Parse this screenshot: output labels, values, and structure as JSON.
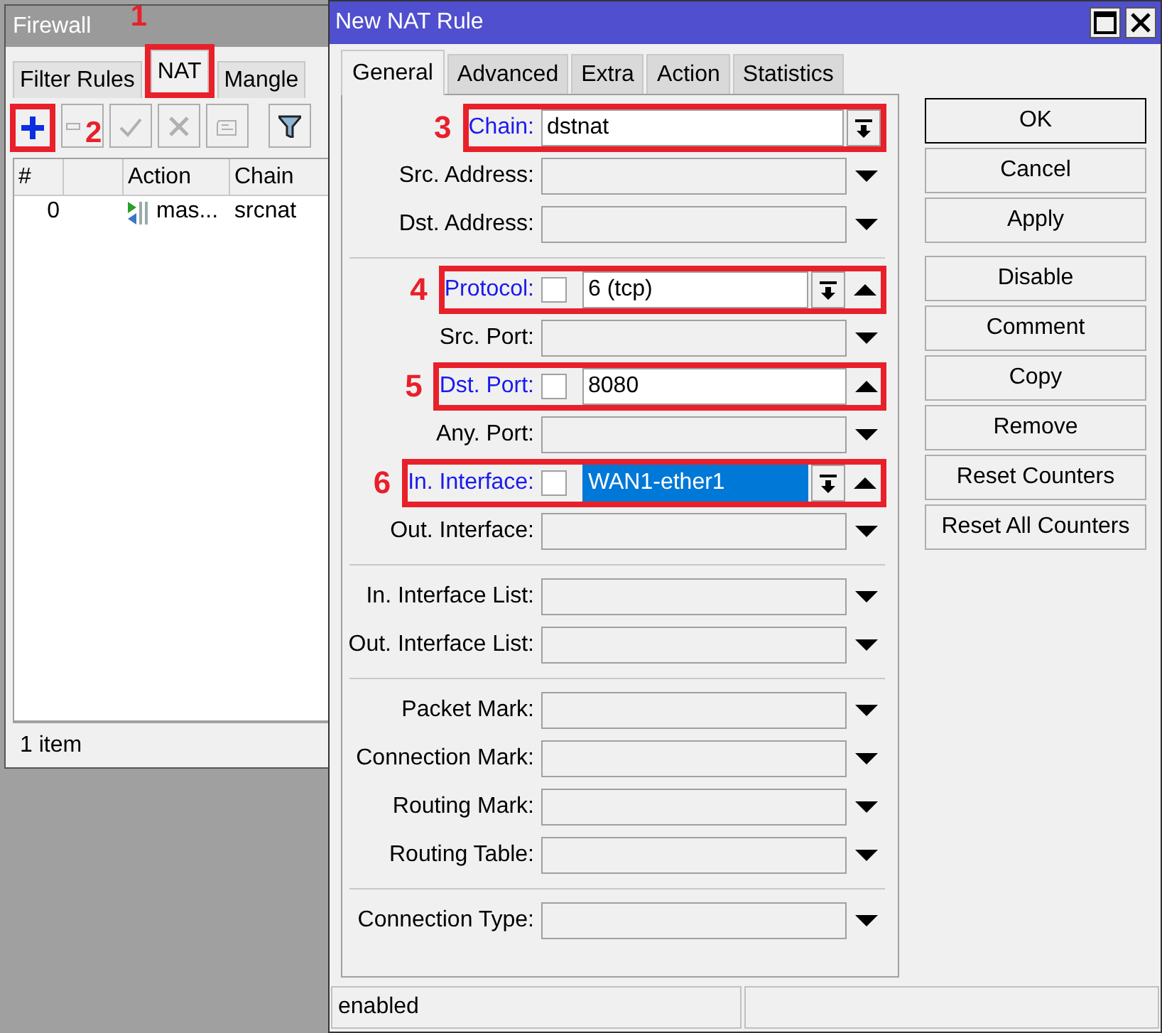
{
  "firewall": {
    "title": "Firewall",
    "tabs": [
      {
        "label": "Filter Rules",
        "selected": false
      },
      {
        "label": "NAT",
        "selected": true,
        "callout": "1"
      },
      {
        "label": "Mangle",
        "selected": false
      }
    ],
    "toolbar": [
      {
        "kind": "add",
        "disabled": false,
        "callout": "2"
      },
      {
        "kind": "remove",
        "disabled": true
      },
      {
        "kind": "enable",
        "disabled": true
      },
      {
        "kind": "disable",
        "disabled": true
      },
      {
        "kind": "comment",
        "disabled": true
      },
      {
        "kind": "filter",
        "disabled": false
      }
    ],
    "table": {
      "columns": [
        {
          "kind": "number",
          "label": "#"
        },
        {
          "kind": "flag"
        },
        {
          "kind": "action",
          "label": "Action"
        },
        {
          "kind": "chain",
          "label": "Chain"
        }
      ],
      "rows": [
        {
          "number": "0",
          "action": "mas...",
          "chain": "srcnat"
        }
      ]
    },
    "status_bar": "1 item"
  },
  "dialog": {
    "title": "New NAT Rule",
    "tabs": [
      {
        "label": "General",
        "selected": true
      },
      {
        "label": "Advanced",
        "selected": false
      },
      {
        "label": "Extra",
        "selected": false
      },
      {
        "label": "Action",
        "selected": false
      },
      {
        "label": "Statistics",
        "selected": false
      }
    ],
    "field_groups": [
      {
        "fields": [
          {
            "kind": "combo",
            "label": "Chain:",
            "value": "dstnat",
            "callout": "3"
          },
          {
            "kind": "unset",
            "label": "Src. Address:"
          },
          {
            "kind": "unset",
            "label": "Dst. Address:"
          }
        ]
      },
      {
        "fields": [
          {
            "kind": "set",
            "label": "Protocol:",
            "value": "6 (tcp)",
            "negate": false,
            "has_combo": true,
            "selected": false,
            "callout": "4"
          },
          {
            "kind": "unset",
            "label": "Src. Port:"
          },
          {
            "kind": "set",
            "label": "Dst. Port:",
            "value": "8080",
            "negate": false,
            "has_combo": false,
            "selected": false,
            "callout": "5"
          },
          {
            "kind": "unset",
            "label": "Any. Port:"
          },
          {
            "kind": "set",
            "label": "In. Interface:",
            "value": "WAN1-ether1",
            "negate": false,
            "has_combo": true,
            "selected": true,
            "callout": "6"
          },
          {
            "kind": "unset",
            "label": "Out. Interface:"
          }
        ]
      },
      {
        "fields": [
          {
            "kind": "unset",
            "label": "In. Interface List:"
          },
          {
            "kind": "unset",
            "label": "Out. Interface List:"
          }
        ]
      },
      {
        "fields": [
          {
            "kind": "unset",
            "label": "Packet Mark:"
          },
          {
            "kind": "unset",
            "label": "Connection Mark:"
          },
          {
            "kind": "unset",
            "label": "Routing Mark:"
          },
          {
            "kind": "unset",
            "label": "Routing Table:"
          }
        ]
      },
      {
        "fields": [
          {
            "kind": "unset",
            "label": "Connection Type:"
          }
        ]
      }
    ],
    "button_groups": [
      {
        "buttons": [
          {
            "label": "OK",
            "default": true
          },
          {
            "label": "Cancel",
            "default": false
          },
          {
            "label": "Apply",
            "default": false
          }
        ]
      },
      {
        "buttons": [
          {
            "label": "Disable",
            "default": false
          },
          {
            "label": "Comment",
            "default": false
          },
          {
            "label": "Copy",
            "default": false
          },
          {
            "label": "Remove",
            "default": false
          },
          {
            "label": "Reset Counters",
            "default": false
          },
          {
            "label": "Reset All Counters",
            "default": false
          }
        ]
      }
    ],
    "status_bar": "enabled"
  }
}
